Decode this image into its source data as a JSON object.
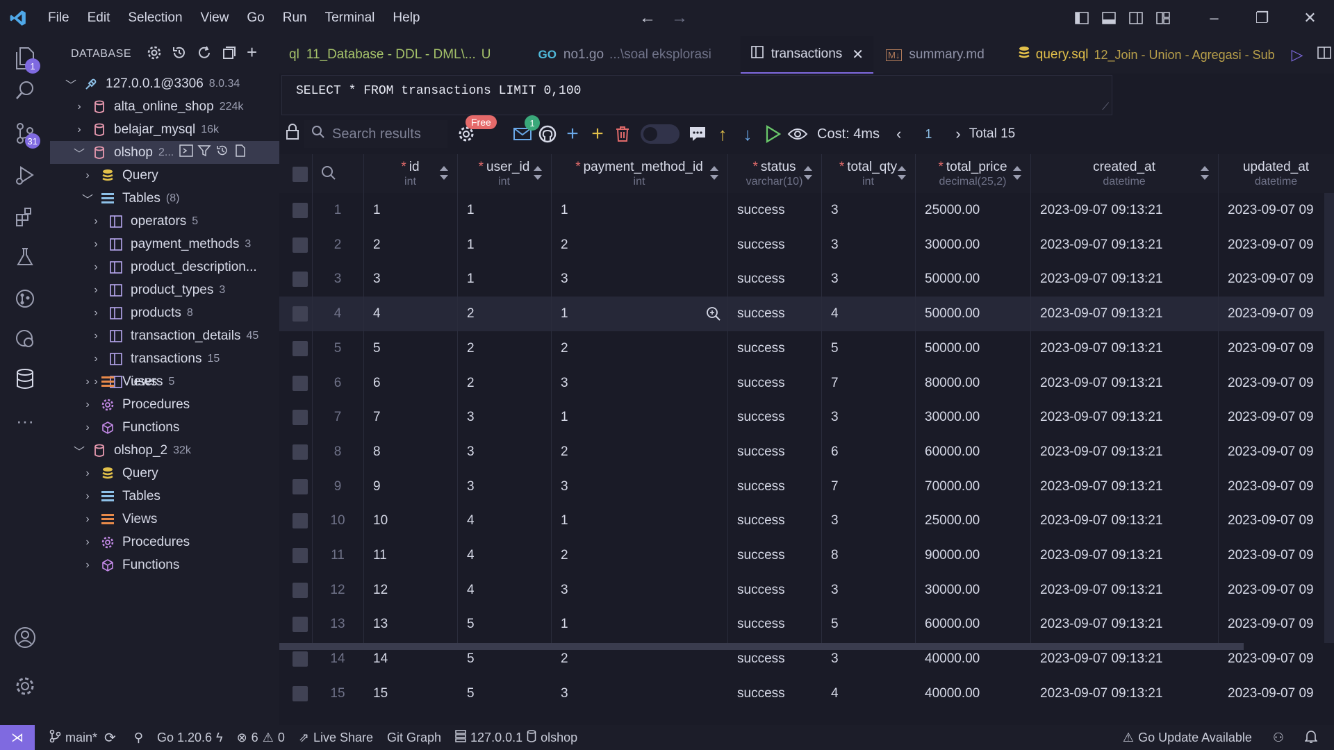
{
  "menu": [
    "File",
    "Edit",
    "Selection",
    "View",
    "Go",
    "Run",
    "Terminal",
    "Help"
  ],
  "activity_badges": {
    "explorer": "1",
    "scm": "31"
  },
  "sidebar": {
    "title": "DATABASE",
    "connection": {
      "name": "127.0.0.1@3306",
      "version": "8.0.34"
    },
    "dbs": [
      {
        "name": "alta_online_shop",
        "size": "224k"
      },
      {
        "name": "belajar_mysql",
        "size": "16k"
      },
      {
        "name": "olshop",
        "size": "2..."
      }
    ],
    "olshop_children": {
      "query": "Query",
      "tables": "Tables",
      "tables_count": "(8)",
      "table_list": [
        {
          "name": "operators",
          "count": "5"
        },
        {
          "name": "payment_methods",
          "count": "3"
        },
        {
          "name": "product_description...",
          "count": ""
        },
        {
          "name": "product_types",
          "count": "3"
        },
        {
          "name": "products",
          "count": "8"
        },
        {
          "name": "transaction_details",
          "count": "45"
        },
        {
          "name": "transactions",
          "count": "15"
        },
        {
          "name": "users",
          "count": "5"
        }
      ],
      "views": "Views",
      "procedures": "Procedures",
      "functions": "Functions"
    },
    "olshop2": {
      "name": "olshop_2",
      "size": "32k",
      "query": "Query",
      "tables": "Tables",
      "views": "Views",
      "procedures": "Procedures",
      "functions": "Functions"
    }
  },
  "tabs": [
    {
      "title": "11_Database - DDL - DML\\...",
      "prefix": "ql",
      "suffix": "U"
    },
    {
      "title": "no1.go",
      "sub": "...\\soal eksplorasi"
    },
    {
      "title": "transactions"
    },
    {
      "title": "summary.md"
    },
    {
      "title": "query.sql",
      "sub": "12_Join - Union - Agregasi - Sub"
    }
  ],
  "query": "SELECT * FROM transactions LIMIT 0,100",
  "toolbar": {
    "search_placeholder": "Search results",
    "free_label": "Free",
    "mail_badge": "1",
    "cost": "Cost: 4ms",
    "page": "1",
    "total": "Total 15"
  },
  "columns": [
    {
      "name": "id",
      "type": "int",
      "required": true
    },
    {
      "name": "user_id",
      "type": "int",
      "required": true
    },
    {
      "name": "payment_method_id",
      "type": "int",
      "required": true
    },
    {
      "name": "status",
      "type": "varchar(10)",
      "required": true
    },
    {
      "name": "total_qty",
      "type": "int",
      "required": true
    },
    {
      "name": "total_price",
      "type": "decimal(25,2)",
      "required": true
    },
    {
      "name": "created_at",
      "type": "datetime",
      "required": false
    },
    {
      "name": "updated_at",
      "type": "datetime",
      "required": false
    }
  ],
  "rows": [
    [
      "1",
      "1",
      "1",
      "success",
      "3",
      "25000.00",
      "2023-09-07 09:13:21",
      "2023-09-07 09"
    ],
    [
      "2",
      "1",
      "2",
      "success",
      "3",
      "30000.00",
      "2023-09-07 09:13:21",
      "2023-09-07 09"
    ],
    [
      "3",
      "1",
      "3",
      "success",
      "3",
      "50000.00",
      "2023-09-07 09:13:21",
      "2023-09-07 09"
    ],
    [
      "4",
      "2",
      "1",
      "success",
      "4",
      "50000.00",
      "2023-09-07 09:13:21",
      "2023-09-07 09"
    ],
    [
      "5",
      "2",
      "2",
      "success",
      "5",
      "50000.00",
      "2023-09-07 09:13:21",
      "2023-09-07 09"
    ],
    [
      "6",
      "2",
      "3",
      "success",
      "7",
      "80000.00",
      "2023-09-07 09:13:21",
      "2023-09-07 09"
    ],
    [
      "7",
      "3",
      "1",
      "success",
      "3",
      "30000.00",
      "2023-09-07 09:13:21",
      "2023-09-07 09"
    ],
    [
      "8",
      "3",
      "2",
      "success",
      "6",
      "60000.00",
      "2023-09-07 09:13:21",
      "2023-09-07 09"
    ],
    [
      "9",
      "3",
      "3",
      "success",
      "7",
      "70000.00",
      "2023-09-07 09:13:21",
      "2023-09-07 09"
    ],
    [
      "10",
      "4",
      "1",
      "success",
      "3",
      "25000.00",
      "2023-09-07 09:13:21",
      "2023-09-07 09"
    ],
    [
      "11",
      "4",
      "2",
      "success",
      "8",
      "90000.00",
      "2023-09-07 09:13:21",
      "2023-09-07 09"
    ],
    [
      "12",
      "4",
      "3",
      "success",
      "3",
      "30000.00",
      "2023-09-07 09:13:21",
      "2023-09-07 09"
    ],
    [
      "13",
      "5",
      "1",
      "success",
      "5",
      "60000.00",
      "2023-09-07 09:13:21",
      "2023-09-07 09"
    ],
    [
      "14",
      "5",
      "2",
      "success",
      "3",
      "40000.00",
      "2023-09-07 09:13:21",
      "2023-09-07 09"
    ],
    [
      "15",
      "5",
      "3",
      "success",
      "4",
      "40000.00",
      "2023-09-07 09:13:21",
      "2023-09-07 09"
    ]
  ],
  "status": {
    "branch": "main*",
    "go_version": "Go 1.20.6",
    "errors": "6",
    "warnings": "0",
    "live_share": "Live Share",
    "git_graph": "Git Graph",
    "host": "127.0.0.1",
    "db": "olshop",
    "go_update": "Go Update Available"
  },
  "colors": {
    "accent": "#7f6ae0",
    "bg": "#1a1b27",
    "panel": "#1c1d29",
    "required": "#e06a6a",
    "yellow": "#e2c04a"
  }
}
